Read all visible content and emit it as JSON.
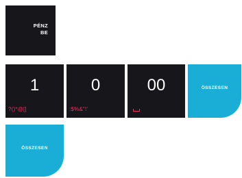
{
  "cash_key": {
    "label": "PÉNZ\n   BE",
    "background": "#16161b"
  },
  "digit_keys": [
    {
      "value": "1",
      "sub": "?()*@[]"
    },
    {
      "value": "0",
      "sub": ":$%&\"!'"
    },
    {
      "value": "00",
      "sub": ""
    }
  ],
  "total_keys": [
    {
      "label": "ÖSSZESEN"
    },
    {
      "label": "ÖSSZESEN"
    }
  ],
  "colors": {
    "key_dark": "#16161b",
    "key_accent": "#1aaed7",
    "key_text": "#ffffff",
    "secondary_text": "#e8305f"
  }
}
